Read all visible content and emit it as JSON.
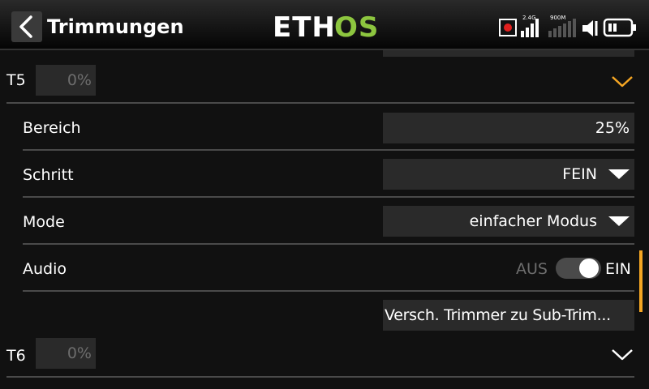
{
  "header": {
    "title": "Trimmungen",
    "logo_left": "ETH",
    "logo_right": "OS",
    "logo_colors": {
      "left": "#ffffff",
      "right": "#8dc63f"
    },
    "rx_band_label": "2.4G",
    "tx_band_label": "900M",
    "icons": [
      "back-arrow-icon",
      "record-icon",
      "signal-bars-icon",
      "speaker-muted-icon",
      "battery-icon"
    ]
  },
  "trims": [
    {
      "name": "T5",
      "value": "0%",
      "expanded": true,
      "chevron_color": "#f5a623",
      "settings": {
        "range_label": "Bereich",
        "range_value": "25%",
        "step_label": "Schritt",
        "step_value": "FEIN",
        "mode_label": "Mode",
        "mode_value": "einfacher Modus",
        "audio_label": "Audio",
        "audio_off": "AUS",
        "audio_on": "EIN",
        "audio_state": true,
        "action_label": "Versch. Trimmer zu Sub-Trim..."
      }
    },
    {
      "name": "T6",
      "value": "0%",
      "expanded": false,
      "chevron_color": "#ffffff"
    }
  ],
  "colors": {
    "accent": "#f5a623",
    "background": "#111111",
    "field": "#2a2a2a"
  }
}
